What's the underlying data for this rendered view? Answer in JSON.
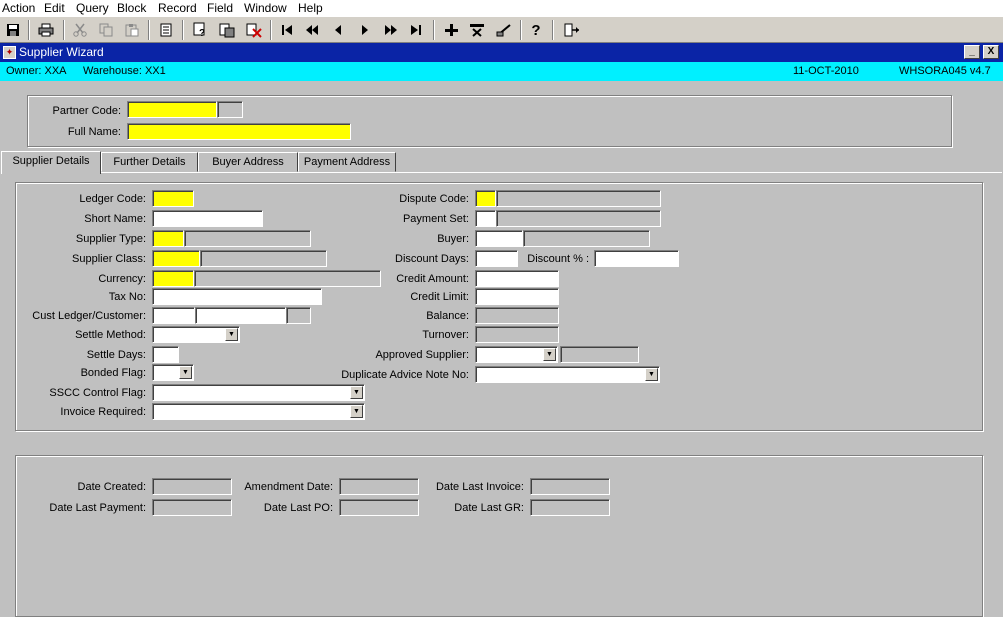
{
  "menu": [
    "Action",
    "Edit",
    "Query",
    "Block",
    "Record",
    "Field",
    "Window",
    "Help"
  ],
  "toolbar": {
    "icons": [
      "save-icon",
      "print-icon",
      "cut-icon",
      "copy-icon",
      "paste-icon",
      "edit-icon",
      "query-icon",
      "execute-query-icon",
      "cancel-query-icon",
      "first-record-icon",
      "previous-set-icon",
      "previous-record-icon",
      "next-record-icon",
      "next-set-icon",
      "last-record-icon",
      "insert-record-icon",
      "delete-record-icon",
      "clear-record-icon",
      "help-icon",
      "exit-icon"
    ],
    "help_glyph": "?"
  },
  "window": {
    "title": "Supplier Wizard",
    "minimize": "_",
    "close": "X"
  },
  "info": {
    "owner": "Owner:  XXA",
    "warehouse": "Warehouse:  XX1",
    "date": "11-OCT-2010",
    "version": "WHSORA045  v4.7"
  },
  "header": {
    "partner_code_label": "Partner Code:",
    "full_name_label": "Full Name:"
  },
  "tabs": [
    "Supplier Details",
    "Further Details",
    "Buyer Address",
    "Payment Address"
  ],
  "details": {
    "ledger_code": "Ledger Code:",
    "short_name": "Short Name:",
    "supplier_type": "Supplier Type:",
    "supplier_class": "Supplier Class:",
    "currency": "Currency:",
    "tax_no": "Tax No:",
    "cust_ledger": "Cust Ledger/Customer:",
    "settle_method": "Settle Method:",
    "settle_days": "Settle Days:",
    "bonded_flag": "Bonded Flag:",
    "sscc_control_flag": "SSCC Control Flag:",
    "invoice_required": "Invoice Required:",
    "dispute_code": "Dispute Code:",
    "payment_set": "Payment Set:",
    "buyer": "Buyer:",
    "discount_days": "Discount Days:",
    "discount_pct": "Discount % :",
    "credit_amount": "Credit Amount:",
    "credit_limit": "Credit Limit:",
    "balance": "Balance:",
    "turnover": "Turnover:",
    "approved_supplier": "Approved Supplier:",
    "duplicate_advice": "Duplicate Advice Note No:"
  },
  "dates": {
    "date_created": "Date Created:",
    "amendment_date": "Amendment Date:",
    "date_last_invoice": "Date Last Invoice:",
    "date_last_payment": "Date Last Payment:",
    "date_last_po": "Date Last PO:",
    "date_last_gr": "Date Last GR:"
  },
  "dropdown_glyph": "▼"
}
